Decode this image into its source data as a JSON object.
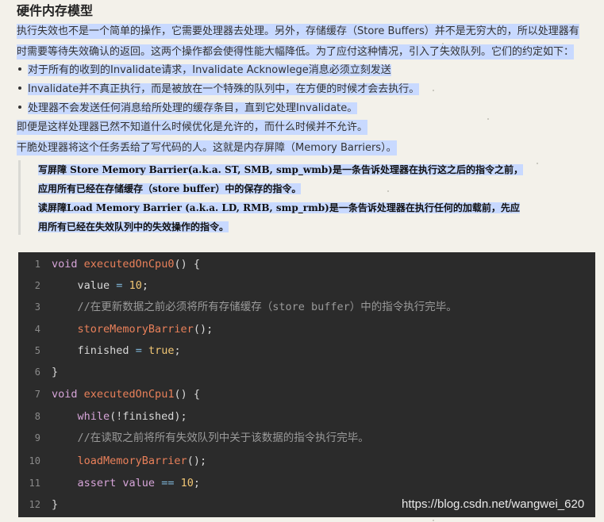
{
  "title": "硬件内存模型",
  "paragraphs": [
    "执行失效也不是一个简单的操作，它需要处理器去处理。另外，存储缓存（Store Buffers）并不是无穷大的，所以处理器有",
    "时需要等待失效确认的返回。这两个操作都会使得性能大幅降低。为了应付这种情况，引入了失效队列。它们的约定如下："
  ],
  "bullets": [
    "对于所有的收到的Invalidate请求，Invalidate Acknowlege消息必须立刻发送",
    "Invalidate并不真正执行，而是被放在一个特殊的队列中，在方便的时候才会去执行。",
    "处理器不会发送任何消息给所处理的缓存条目，直到它处理Invalidate。"
  ],
  "after_bullets": [
    "即便是这样处理器已然不知道什么时候优化是允许的，而什么时候并不允许。",
    "干脆处理器将这个任务丢给了写代码的人。这就是内存屏障（Memory Barriers）。"
  ],
  "quote_lines": [
    "写屏障 Store Memory Barrier(a.k.a. ST, SMB, smp_wmb)是一条告诉处理器在执行这之后的指令之前，",
    "应用所有已经在存储缓存（store buffer）中的保存的指令。",
    "读屏障Load Memory Barrier (a.k.a. LD, RMB, smp_rmb)是一条告诉处理器在执行任何的加载前，先应",
    "用所有已经在失效队列中的失效操作的指令。"
  ],
  "code": {
    "line_numbers": [
      "1",
      "2",
      "3",
      "4",
      "5",
      "6",
      "7",
      "8",
      "9",
      "10",
      "11",
      "12"
    ],
    "tokens": {
      "void": "void",
      "fn_cpu0": "executedOnCpu0",
      "fn_cpu1": "executedOnCpu1",
      "open": "() {",
      "close": "}",
      "value": "value",
      "eq": "=",
      "ten": "10",
      "semi": ";",
      "comment1": "//在更新数据之前必须将所有存储缓存（store buffer）中的指令执行完毕。",
      "store_barrier": "storeMemoryBarrier",
      "call": "();",
      "finished": "finished",
      "true": "true",
      "while": "while",
      "while_args": "(!finished);",
      "comment2": "//在读取之前将所有失效队列中关于该数据的指令执行完毕。",
      "load_barrier": "loadMemoryBarrier",
      "assert": "assert value",
      "eqeq": "=="
    }
  },
  "watermark": "https://blog.csdn.net/wangwei_620"
}
